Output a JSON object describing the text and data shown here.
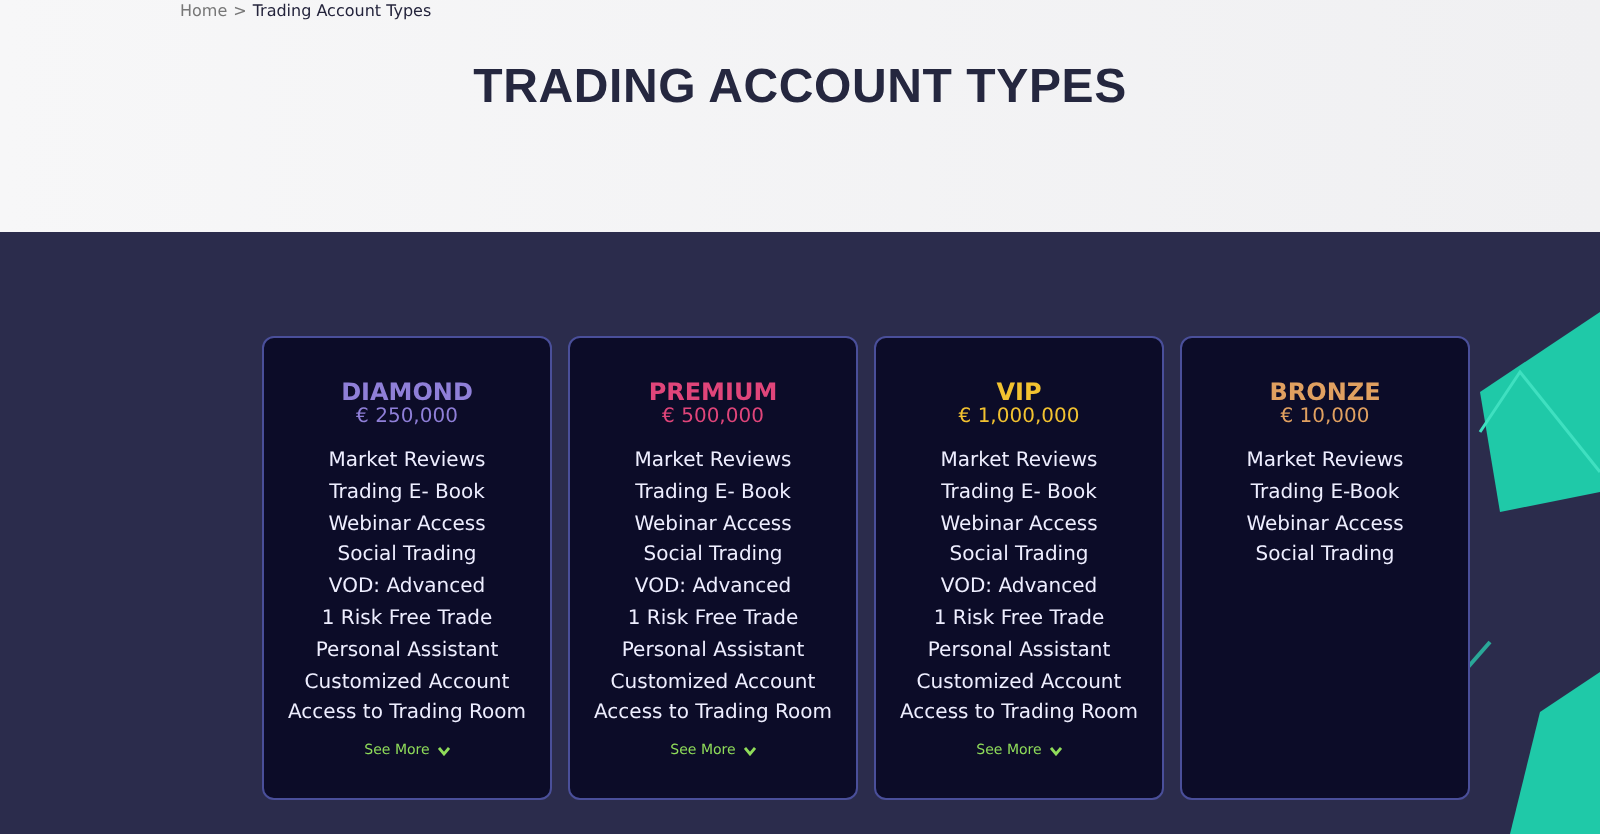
{
  "breadcrumb": {
    "items": [
      "Home",
      "Trading Account Types"
    ],
    "separator": ">"
  },
  "title": "TRADING ACCOUNT TYPES",
  "plans": [
    {
      "name": "DIAMOND",
      "price": "€ 250,000",
      "color": "#8f7fd8",
      "features": [
        "Market Reviews",
        "Trading E- Book",
        "Webinar Access",
        "Social Trading",
        "VOD: Advanced",
        "1 Risk Free Trade",
        "Personal Assistant",
        "Customized Account",
        "Access to Trading Room"
      ],
      "see_more": "See More"
    },
    {
      "name": "PREMIUM",
      "price": "€ 500,000",
      "color": "#e0457a",
      "features": [
        "Market Reviews",
        "Trading E- Book",
        "Webinar Access",
        "Social Trading",
        "VOD: Advanced",
        "1 Risk Free Trade",
        "Personal Assistant",
        "Customized Account",
        "Access to Trading Room"
      ],
      "see_more": "See More"
    },
    {
      "name": "VIP",
      "price": "€ 1,000,000",
      "color": "#f2c230",
      "features": [
        "Market Reviews",
        "Trading E- Book",
        "Webinar Access",
        "Social Trading",
        "VOD: Advanced",
        "1 Risk Free Trade",
        "Personal Assistant",
        "Customized Account",
        "Access to Trading Room"
      ],
      "see_more": "See More"
    },
    {
      "name": "BRONZE",
      "price": "€ 10,000",
      "color": "#e0a060",
      "features": [
        "Market Reviews",
        "Trading E-Book",
        "Webinar Access",
        "Social Trading"
      ]
    }
  ]
}
